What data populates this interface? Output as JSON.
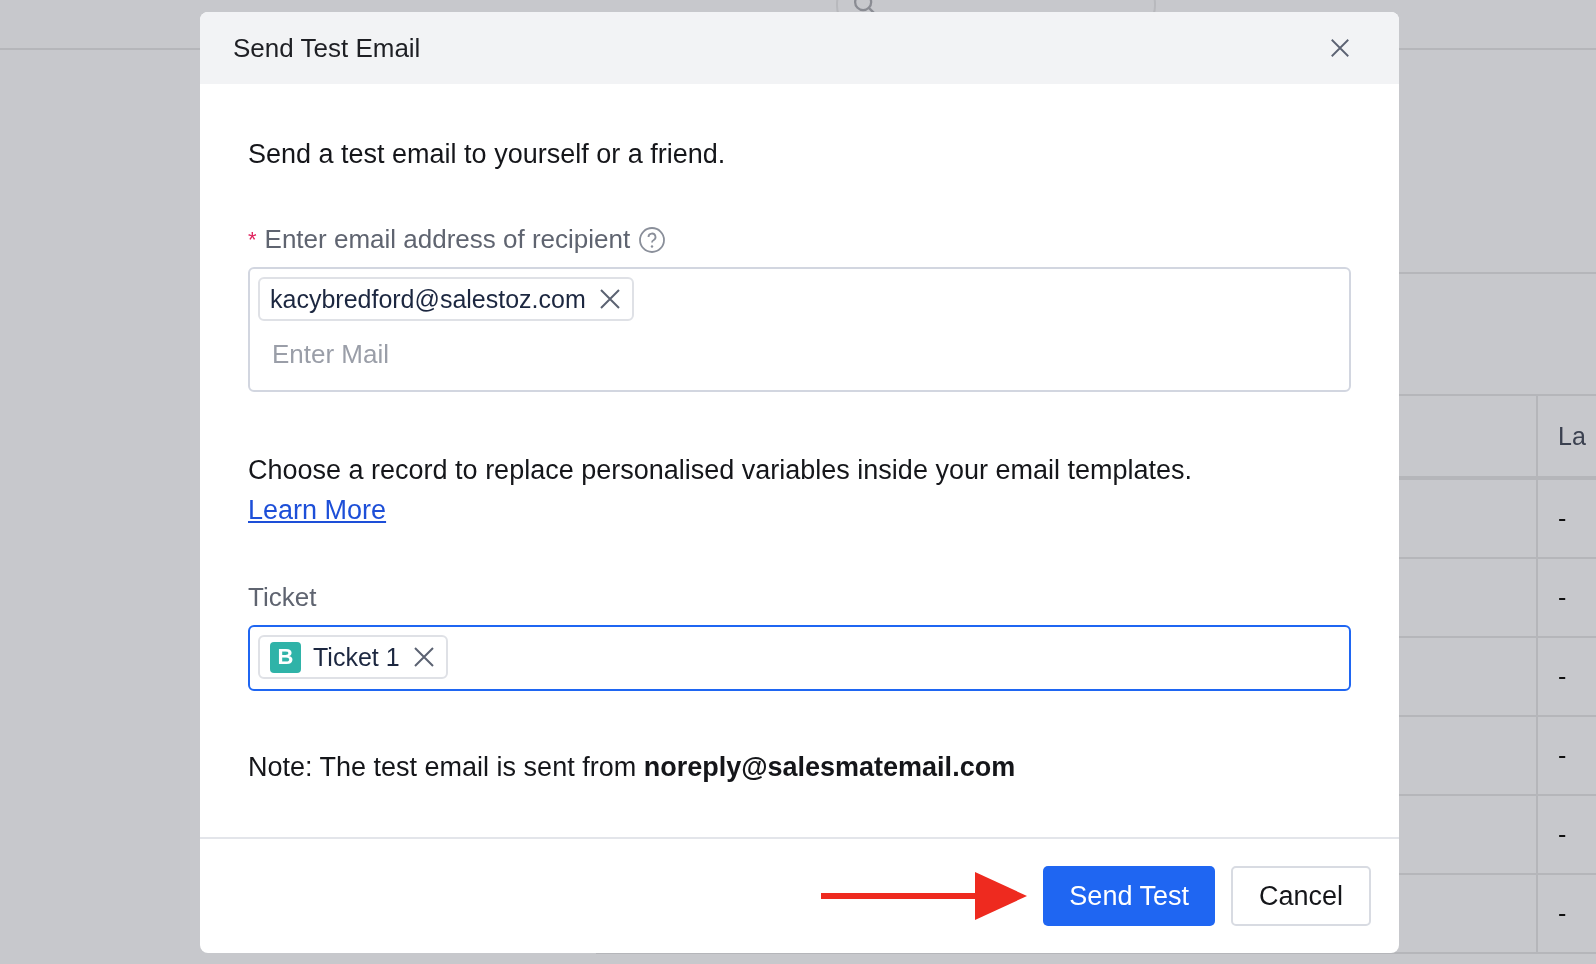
{
  "background": {
    "table": {
      "columns": [
        "La"
      ],
      "rows": [
        "-",
        "-",
        "-",
        "-",
        "-",
        "-"
      ]
    }
  },
  "dialog": {
    "title": "Send Test Email",
    "description": "Send a test email to yourself or a friend.",
    "recipient": {
      "label": "Enter email address of recipient",
      "required_mark": "*",
      "chips": [
        {
          "text": "kacybredford@salestoz.com"
        }
      ],
      "placeholder": "Enter Mail"
    },
    "record_note": "Choose a record to replace personalised variables inside your email templates.",
    "learn_more": "Learn More",
    "ticket": {
      "label": "Ticket",
      "focused": true,
      "chips": [
        {
          "badge": "B",
          "text": "Ticket 1"
        }
      ]
    },
    "note": "Note: The test email is sent from **noreply@salesmatemail.com**",
    "buttons": [
      {
        "label": "Send Test",
        "kind": "primary"
      },
      {
        "label": "Cancel",
        "kind": "secondary"
      }
    ]
  }
}
